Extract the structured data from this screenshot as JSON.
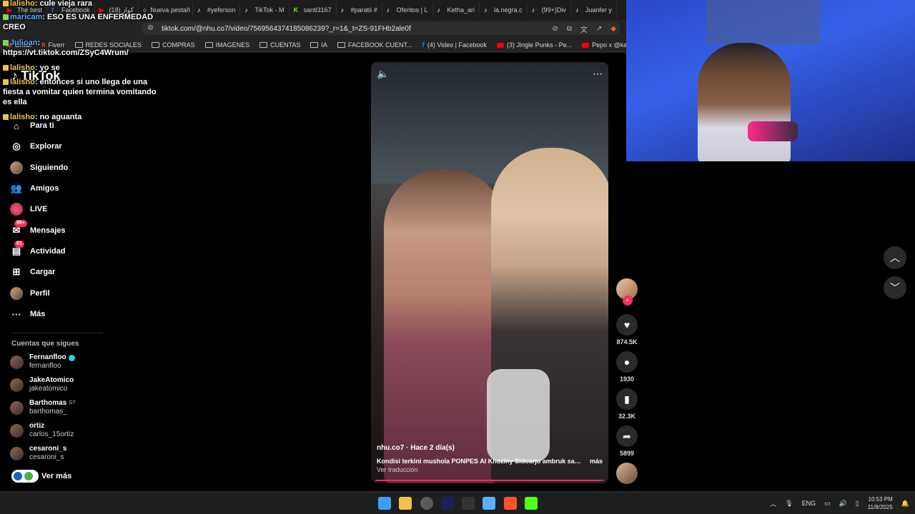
{
  "browser": {
    "tabs": [
      {
        "label": "The best",
        "icon": "youtube-icon"
      },
      {
        "label": "Facebook",
        "icon": "facebook-icon"
      },
      {
        "label": "(18) كواز",
        "icon": "youtube-icon"
      },
      {
        "label": "Nueva pestañ",
        "icon": "tab-icon"
      },
      {
        "label": "#yeferson",
        "icon": "tiktok-icon"
      },
      {
        "label": "TikTok - M",
        "icon": "tiktok-icon"
      },
      {
        "label": "santi3167",
        "icon": "kick-icon"
      },
      {
        "label": "#paratii #",
        "icon": "tiktok-icon"
      },
      {
        "label": "Oferitos | L",
        "icon": "tiktok-icon"
      },
      {
        "label": "Ketha_ari",
        "icon": "tiktok-icon"
      },
      {
        "label": "la.negra.c",
        "icon": "tiktok-icon"
      },
      {
        "label": "(99+)Div",
        "icon": "tiktok-icon"
      },
      {
        "label": "Juanfer y",
        "icon": "tiktok-icon"
      }
    ],
    "url": "tiktok.com/@nhu.co7/video/7569564374185086239?_r=1&_t=ZS-91FHb2ale0f",
    "bookmarks": [
      {
        "label": "Gmail",
        "icon": "gmail-icon"
      },
      {
        "label": "Fiverr",
        "icon": "fiverr-icon"
      },
      {
        "label": "REDES SOCIALES",
        "icon": "folder-icon"
      },
      {
        "label": "COMPRAS",
        "icon": "folder-icon"
      },
      {
        "label": "IMAGENES",
        "icon": "folder-icon"
      },
      {
        "label": "CUENTAS",
        "icon": "folder-icon"
      },
      {
        "label": "IA",
        "icon": "folder-icon"
      },
      {
        "label": "FACEBOOK CUENT...",
        "icon": "folder-icon"
      },
      {
        "label": "(4) Video | Facebook",
        "icon": "facebook-icon"
      },
      {
        "label": "(3) Jingle Punks - Pe...",
        "icon": "youtube-icon"
      },
      {
        "label": "Pepo x @kazu.oficia...",
        "icon": "youtube-icon"
      }
    ]
  },
  "tiktok": {
    "logo": "TikTok",
    "nav": [
      {
        "label": "Para ti",
        "icon": "home-icon"
      },
      {
        "label": "Explorar",
        "icon": "compass-icon"
      },
      {
        "label": "Siguiendo",
        "icon": "following-avatar-icon"
      },
      {
        "label": "Amigos",
        "icon": "friends-icon"
      },
      {
        "label": "LIVE",
        "icon": "live-icon"
      },
      {
        "label": "Mensajes",
        "icon": "messages-icon",
        "badge": "99+"
      },
      {
        "label": "Actividad",
        "icon": "activity-icon",
        "badge": "51"
      },
      {
        "label": "Cargar",
        "icon": "upload-icon"
      },
      {
        "label": "Perfil",
        "icon": "profile-icon"
      },
      {
        "label": "Más",
        "icon": "more-icon"
      }
    ],
    "following_title": "Cuentas que sigues",
    "following": [
      {
        "name": "Fernanfloo",
        "username": "fernanfloo",
        "verified": true,
        "tag": ""
      },
      {
        "name": "JakeAtomico",
        "username": "jakeatomico",
        "verified": false,
        "tag": ""
      },
      {
        "name": "Barthomas",
        "username": "barthomas_",
        "verified": false,
        "tag": "GT"
      },
      {
        "name": "ortiz",
        "username": "carlos_15ortiz",
        "verified": false,
        "tag": ""
      },
      {
        "name": "cesaroni_s",
        "username": "cesaroni_s",
        "verified": false,
        "tag": ""
      }
    ],
    "see_more": "Ver más",
    "video": {
      "author_line": "nhu.co7 · Hace 2 día(s)",
      "description": "Kondisi terkini mushola PONPES Al Khoziny Sidoarjo ambruk saat ...",
      "more": "más",
      "translate": "Ver traducción",
      "progress": 0.99
    },
    "actions": {
      "likes": "874.5K",
      "comments": "1930",
      "saves": "32.3K",
      "shares": "5899"
    }
  },
  "chat": [
    {
      "user": "lalisho",
      "text": "cule vieja rara"
    },
    {
      "user": "maricam",
      "text": "ESO ES UNA ENFERMEDAD CREO"
    },
    {
      "user": "Julioan",
      "text": "https://vt.tiktok.com/ZSyC4Wrum/"
    },
    {
      "user": "lalisho",
      "text": "yo se"
    },
    {
      "user": "lalisho",
      "text": "entonces si uno llega de una fiesta a vomitar quien termina vomitando es ella"
    },
    {
      "user": "lalisho",
      "text": "no aguanta"
    }
  ],
  "taskbar": {
    "language": "ENG",
    "time": "10:53 PM",
    "date": "11/8/2025"
  }
}
